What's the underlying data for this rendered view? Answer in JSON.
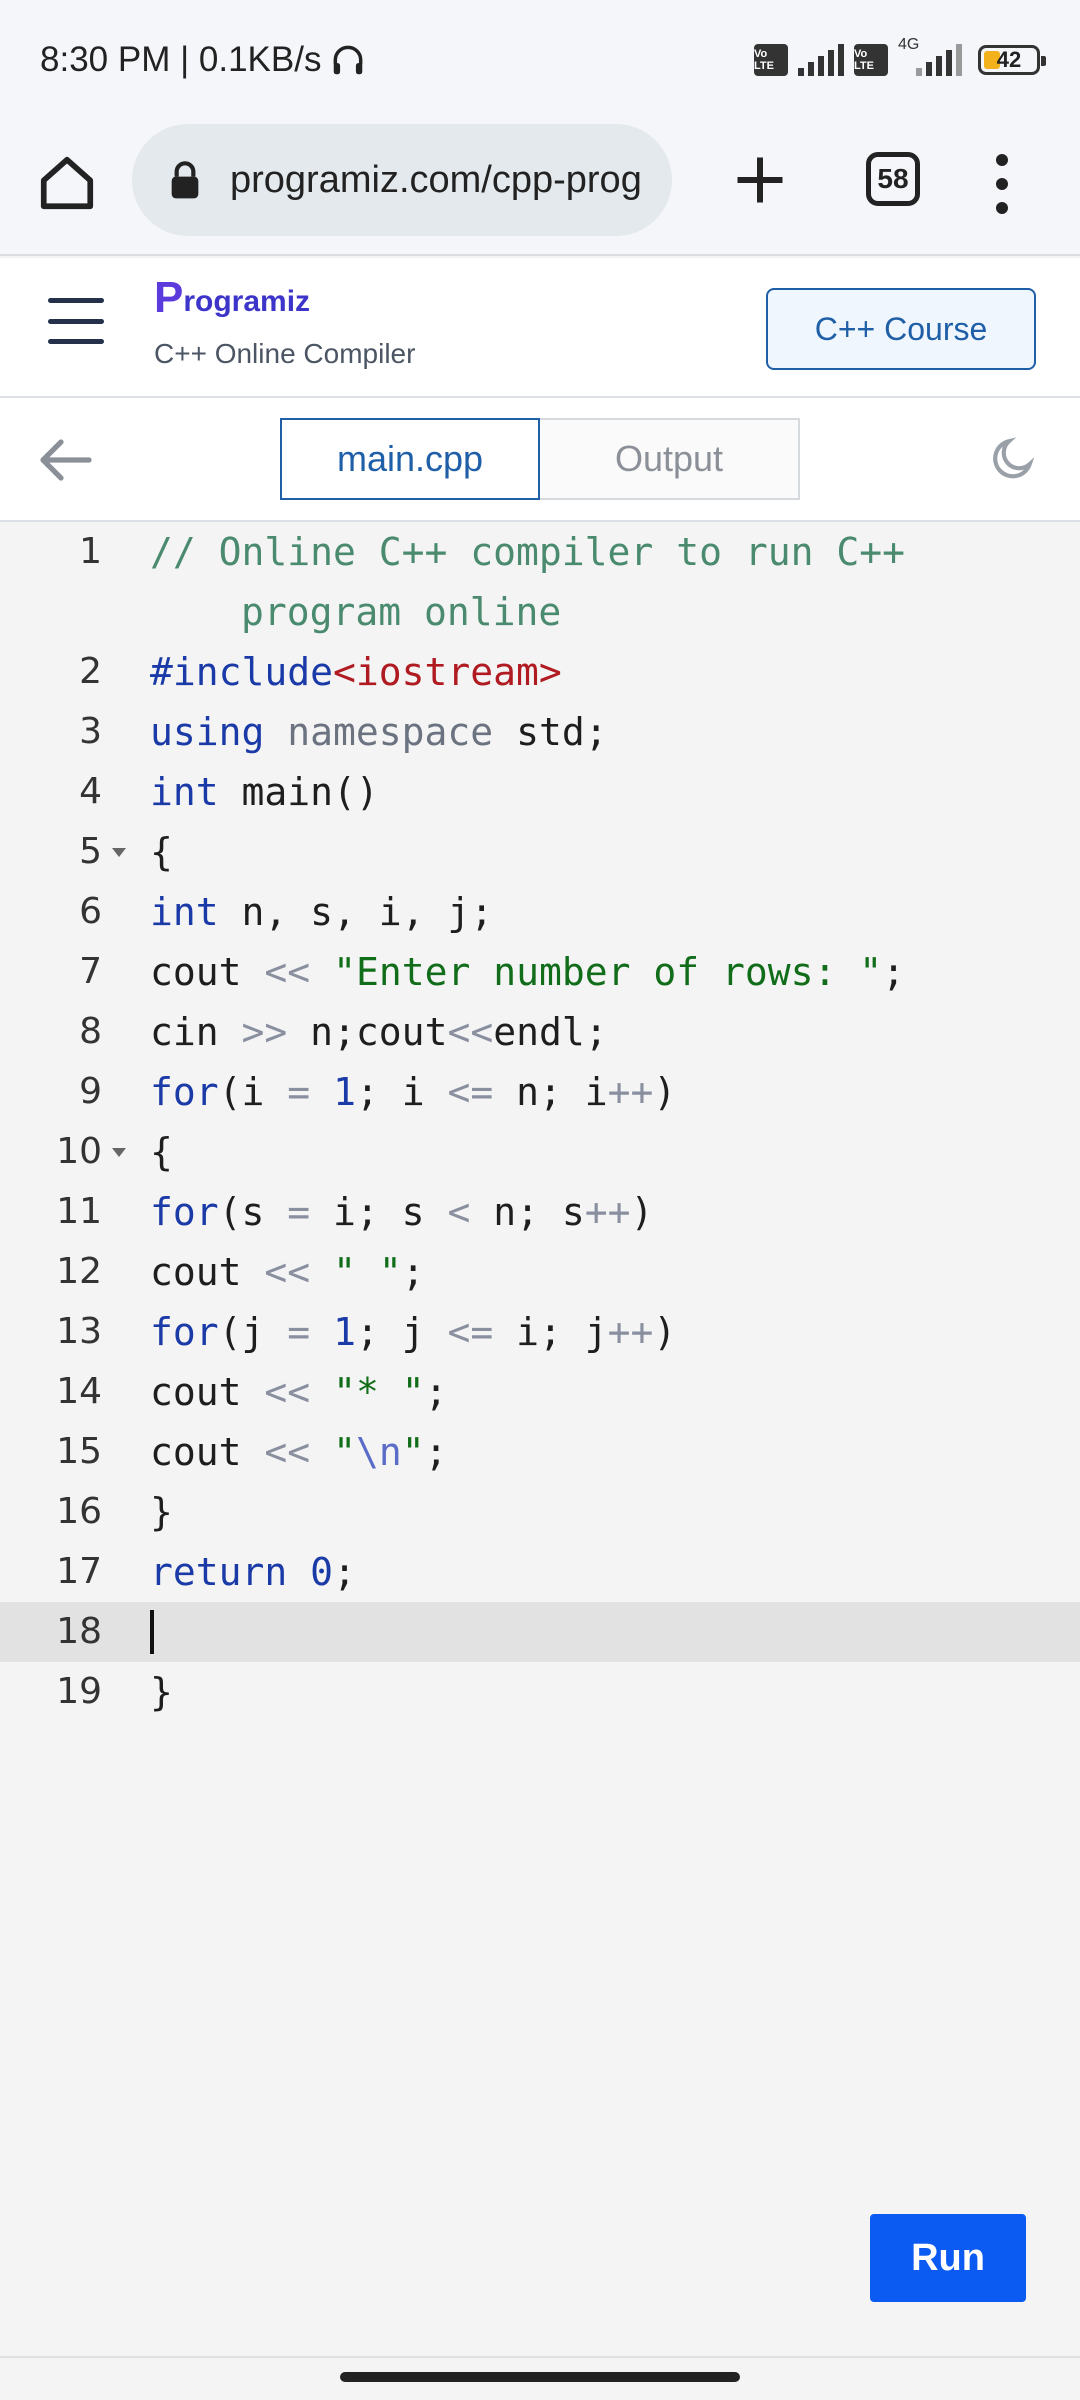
{
  "status_bar": {
    "time_speed": "8:30 PM | 0.1KB/s",
    "sim1_tag": "Vo LTE",
    "sim2_tag": "Vo LTE",
    "net_type": "4G",
    "battery": "42"
  },
  "browser": {
    "url": "programiz.com/cpp-prog",
    "tab_count": "58"
  },
  "site": {
    "logo_p": "P",
    "logo_rest": "rogramiz",
    "subtitle": "C++ Online Compiler",
    "course_button": "C++ Course"
  },
  "toolbar": {
    "tab_file": "main.cpp",
    "tab_output": "Output"
  },
  "editor": {
    "line_numbers": [
      "1",
      "2",
      "3",
      "4",
      "5",
      "6",
      "7",
      "8",
      "9",
      "10",
      "11",
      "12",
      "13",
      "14",
      "15",
      "16",
      "17",
      "18",
      "19"
    ],
    "comment_part1": "// Online C++ compiler to run C++",
    "comment_part2": "program online",
    "l2_include": "#include",
    "l2_header": "<iostream>",
    "l3_using": "using",
    "l3_namespace": "namespace",
    "l3_std": " std;",
    "l4_int": "int",
    "l4_rest": " main()",
    "brace_open": "{",
    "l6_int": "int",
    "l6_rest": " n, s, i, j;",
    "cout": "cout",
    "cin": "cin",
    "shl": "<<",
    "shr": ">>",
    "l7_str": "\"Enter number of rows: \"",
    "semi": ";",
    "l8_rest1": " n;cout",
    "l8_rest2": "endl;",
    "for_kw": "for",
    "l9_a": "(i ",
    "eq": "=",
    "one": "1",
    "l9_b": "; i ",
    "le": "<=",
    "l9_c": " n; i",
    "inc": "++",
    "rparen": ")",
    "l11_a": "(s ",
    "l11_b": " i; s ",
    "lt": "<",
    "l11_c": " n; s",
    "l12_str": "\" \"",
    "l13_a": "(j ",
    "l13_b": "; j ",
    "l13_c": " i; j",
    "l14_str": "\"* \"",
    "quote": "\"",
    "esc_n": "\\n",
    "brace_close": "}",
    "return_kw": "return",
    "zero": "0"
  },
  "run_button": "Run"
}
